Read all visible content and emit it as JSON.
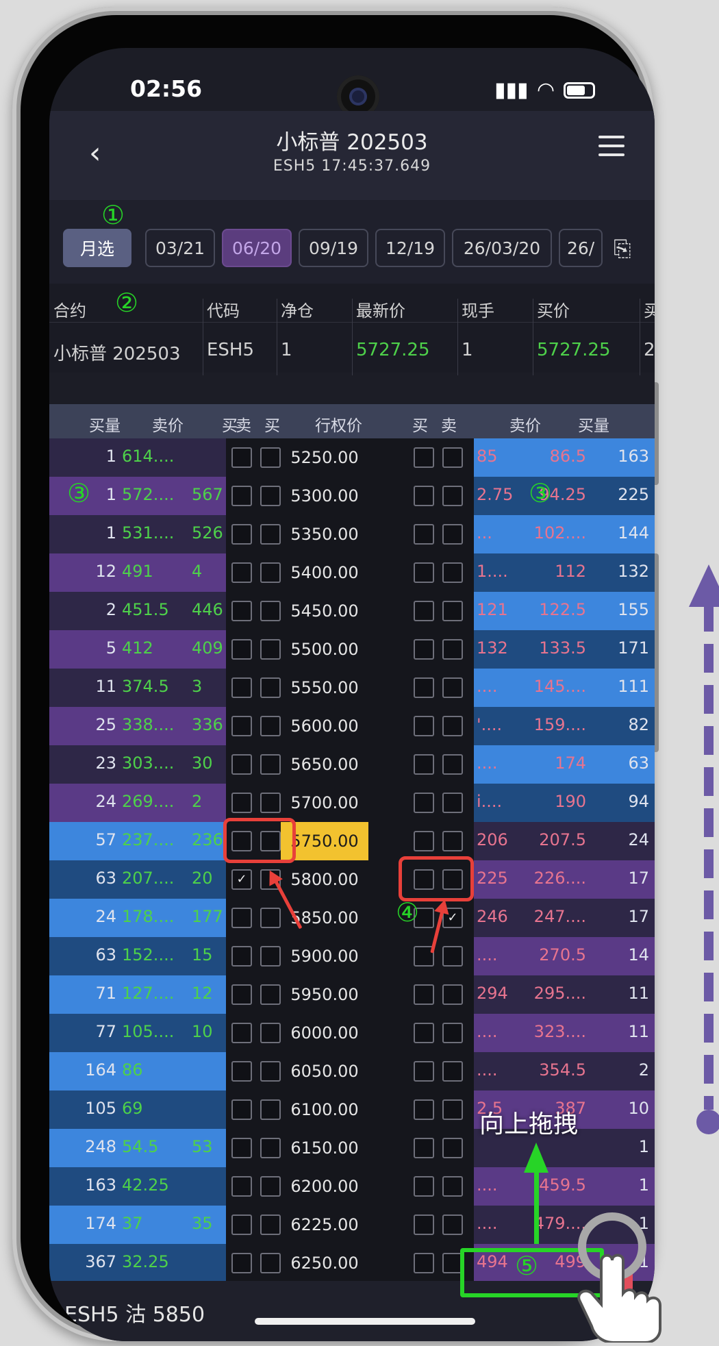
{
  "status": {
    "time": "02:56"
  },
  "header": {
    "title": "小标普 202503",
    "subtitle": "ESH5   17:45:37.649"
  },
  "tabs": {
    "monthly": "月选",
    "items": [
      "03/21",
      "06/20",
      "09/19",
      "12/19",
      "26/03/20",
      "26/"
    ]
  },
  "info": {
    "headers": [
      "合约",
      "代码",
      "净仓",
      "最新价",
      "现手",
      "买价",
      "买"
    ],
    "values": [
      "小标普 202503",
      "ESH5",
      "1",
      "5727.25",
      "1",
      "5727.25",
      "2"
    ]
  },
  "table_header": {
    "left": [
      "买量",
      "卖价",
      "买"
    ],
    "mid": [
      "卖",
      "买",
      "行权价",
      "买",
      "卖"
    ],
    "right": [
      "卖价",
      "买量"
    ]
  },
  "rows": [
    {
      "lq": "1",
      "lp": "614....",
      "lx": "",
      "strike": "5250.00",
      "rx": "85",
      "rp": "86.5",
      "rq": "163"
    },
    {
      "lq": "1",
      "lp": "572....",
      "lx": "567",
      "strike": "5300.00",
      "rx": "2.75",
      "rp": "94.25",
      "rq": "225"
    },
    {
      "lq": "1",
      "lp": "531....",
      "lx": "526",
      "strike": "5350.00",
      "rx": "...",
      "rp": "102....",
      "rq": "144"
    },
    {
      "lq": "12",
      "lp": "491",
      "lx": "4",
      "strike": "5400.00",
      "rx": "1....",
      "rp": "112",
      "rq": "132"
    },
    {
      "lq": "2",
      "lp": "451.5",
      "lx": "446",
      "strike": "5450.00",
      "rx": "121",
      "rp": "122.5",
      "rq": "155"
    },
    {
      "lq": "5",
      "lp": "412",
      "lx": "409",
      "strike": "5500.00",
      "rx": "132",
      "rp": "133.5",
      "rq": "171"
    },
    {
      "lq": "11",
      "lp": "374.5",
      "lx": "3",
      "strike": "5550.00",
      "rx": "....",
      "rp": "145....",
      "rq": "111"
    },
    {
      "lq": "25",
      "lp": "338....",
      "lx": "336",
      "strike": "5600.00",
      "rx": "'....",
      "rp": "159....",
      "rq": "82"
    },
    {
      "lq": "23",
      "lp": "303....",
      "lx": "30",
      "strike": "5650.00",
      "rx": "....",
      "rp": "174",
      "rq": "63"
    },
    {
      "lq": "24",
      "lp": "269....",
      "lx": "2",
      "strike": "5700.00",
      "rx": "i....",
      "rp": "190",
      "rq": "94"
    },
    {
      "lq": "57",
      "lp": "237....",
      "lx": "236",
      "strike": "5750.00",
      "rx": "206",
      "rp": "207.5",
      "rq": "24"
    },
    {
      "lq": "63",
      "lp": "207....",
      "lx": "20",
      "strike": "5800.00",
      "rx": "225",
      "rp": "226....",
      "rq": "17"
    },
    {
      "lq": "24",
      "lp": "178....",
      "lx": "177",
      "strike": "5850.00",
      "rx": "246",
      "rp": "247....",
      "rq": "17"
    },
    {
      "lq": "63",
      "lp": "152....",
      "lx": "15",
      "strike": "5900.00",
      "rx": "....",
      "rp": "270.5",
      "rq": "14"
    },
    {
      "lq": "71",
      "lp": "127....",
      "lx": "12",
      "strike": "5950.00",
      "rx": "294",
      "rp": "295....",
      "rq": "11"
    },
    {
      "lq": "77",
      "lp": "105....",
      "lx": "10",
      "strike": "6000.00",
      "rx": "....",
      "rp": "323....",
      "rq": "11"
    },
    {
      "lq": "164",
      "lp": "86",
      "lx": "",
      "strike": "6050.00",
      "rx": "....",
      "rp": "354.5",
      "rq": "2"
    },
    {
      "lq": "105",
      "lp": "69",
      "lx": "",
      "strike": "6100.00",
      "rx": "2.5",
      "rp": "387",
      "rq": "10"
    },
    {
      "lq": "248",
      "lp": "54.5",
      "lx": "53",
      "strike": "6150.00",
      "rx": "",
      "rp": "",
      "rq": "1"
    },
    {
      "lq": "163",
      "lp": "42.25",
      "lx": "",
      "strike": "6200.00",
      "rx": "....",
      "rp": "459.5",
      "rq": "1"
    },
    {
      "lq": "174",
      "lp": "37",
      "lx": "35",
      "strike": "6225.00",
      "rx": "....",
      "rp": "479....",
      "rq": "1"
    },
    {
      "lq": "367",
      "lp": "32.25",
      "lx": "",
      "strike": "6250.00",
      "rx": "494",
      "rp": "499",
      "rq": "1"
    }
  ],
  "bottom": {
    "label": "ESH5 沽 5850"
  },
  "annotations": {
    "n1": "①",
    "n2": "②",
    "n3": "③",
    "n4": "④",
    "n5": "⑤",
    "drag": "向上拖拽"
  },
  "colors": {
    "purple_dark": "#2e2747",
    "purple": "#5a3a86",
    "blue": "#3d86dd",
    "blue_dark": "#1f4b80",
    "atm": "#f2c22f",
    "green_price": "#4ed14a",
    "red_price": "#e7748f",
    "annotation_green": "#27d427",
    "annotation_red": "#e8403a"
  }
}
